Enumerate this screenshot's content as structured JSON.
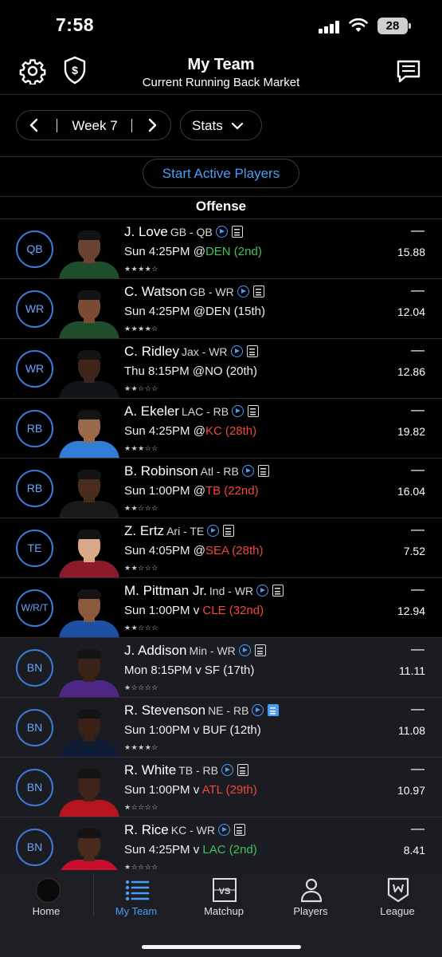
{
  "status_bar": {
    "time": "7:58",
    "battery": "28"
  },
  "header": {
    "title": "My Team",
    "subtitle": "Current Running Back Market"
  },
  "week": {
    "label": "Week 7"
  },
  "stats": {
    "label": "Stats"
  },
  "start_button": {
    "label": "Start Active Players"
  },
  "section": {
    "title": "Offense"
  },
  "players": [
    {
      "pos": "QB",
      "name": "J. Love",
      "team": "GB - QB",
      "game": "Sun 4:25PM @",
      "opp": "DEN (2nd)",
      "opp_rank": "good",
      "stars": "★★★★☆",
      "dash": "—",
      "points": "15.88",
      "skin": "#6b4330",
      "jersey": "#1f4d2b",
      "bench": false
    },
    {
      "pos": "WR",
      "name": "C. Watson",
      "team": "GB - WR",
      "game": "Sun 4:25PM @DEN (15th)",
      "opp": "",
      "opp_rank": "",
      "stars": "★★★★☆",
      "dash": "—",
      "points": "12.04",
      "skin": "#7a4a33",
      "jersey": "#1f4d2b",
      "bench": false
    },
    {
      "pos": "WR",
      "name": "C. Ridley",
      "team": "Jax - WR",
      "game": "Thu 8:15PM @NO (20th)",
      "opp": "",
      "opp_rank": "",
      "stars": "★★☆☆☆",
      "dash": "—",
      "points": "12.86",
      "skin": "#3e2519",
      "jersey": "#111418",
      "bench": false
    },
    {
      "pos": "RB",
      "name": "A. Ekeler",
      "team": "LAC - RB",
      "game": "Sun 4:25PM @",
      "opp": "KC (28th)",
      "opp_rank": "bad",
      "stars": "★★★☆☆",
      "dash": "—",
      "points": "19.82",
      "skin": "#9b6a4c",
      "jersey": "#2f7fd6",
      "bench": false
    },
    {
      "pos": "RB",
      "name": "B. Robinson",
      "team": "Atl - RB",
      "game": "Sun 1:00PM @",
      "opp": "TB (22nd)",
      "opp_rank": "bad",
      "stars": "★★☆☆☆",
      "dash": "—",
      "points": "16.04",
      "skin": "#4a2c1e",
      "jersey": "#1a1a1a",
      "bench": false
    },
    {
      "pos": "TE",
      "name": "Z. Ertz",
      "team": "Ari - TE",
      "game": "Sun 4:05PM @",
      "opp": "SEA (28th)",
      "opp_rank": "bad",
      "stars": "★★☆☆☆",
      "dash": "—",
      "points": "7.52",
      "skin": "#d9a887",
      "jersey": "#8b1b2a",
      "bench": false
    },
    {
      "pos": "W/R/T",
      "name": "M. Pittman Jr.",
      "team": "Ind - WR",
      "game": "Sun 1:00PM v ",
      "opp": "CLE (32nd)",
      "opp_rank": "bad",
      "stars": "★★☆☆☆",
      "dash": "—",
      "points": "12.94",
      "skin": "#8a5a3c",
      "jersey": "#1d4fa3",
      "bench": false
    },
    {
      "pos": "BN",
      "name": "J. Addison",
      "team": "Min - WR",
      "game": "Mon 8:15PM v SF (17th)",
      "opp": "",
      "opp_rank": "",
      "stars": "★☆☆☆☆",
      "dash": "—",
      "points": "11.11",
      "skin": "#3b2218",
      "jersey": "#4f2683",
      "bench": true
    },
    {
      "pos": "BN",
      "name": "R. Stevenson",
      "team": "NE - RB",
      "game": "Sun 1:00PM v BUF (12th)",
      "opp": "",
      "opp_rank": "",
      "stars": "★★★★☆",
      "dash": "—",
      "points": "11.08",
      "skin": "#3a2117",
      "jersey": "#0f1c35",
      "bench": true
    },
    {
      "pos": "BN",
      "name": "R. White",
      "team": "TB - RB",
      "game": "Sun 1:00PM v ",
      "opp": "ATL (29th)",
      "opp_rank": "bad",
      "stars": "★☆☆☆☆",
      "dash": "—",
      "points": "10.97",
      "skin": "#3f2519",
      "jersey": "#b5161e",
      "bench": true
    },
    {
      "pos": "BN",
      "name": "R. Rice",
      "team": "KC - WR",
      "game": "Sun 4:25PM v ",
      "opp": "LAC (2nd)",
      "opp_rank": "good",
      "stars": "★☆☆☆☆",
      "dash": "—",
      "points": "8.41",
      "skin": "#4a2a1c",
      "jersey": "#c8102e",
      "bench": true
    }
  ],
  "nav": [
    {
      "label": "Home"
    },
    {
      "label": "My Team"
    },
    {
      "label": "Matchup"
    },
    {
      "label": "Players"
    },
    {
      "label": "League"
    }
  ],
  "colors": {
    "accent": "#4a9df5",
    "good": "#3fc35b",
    "bad": "#f0473c",
    "badge": "#3e7bd8"
  }
}
